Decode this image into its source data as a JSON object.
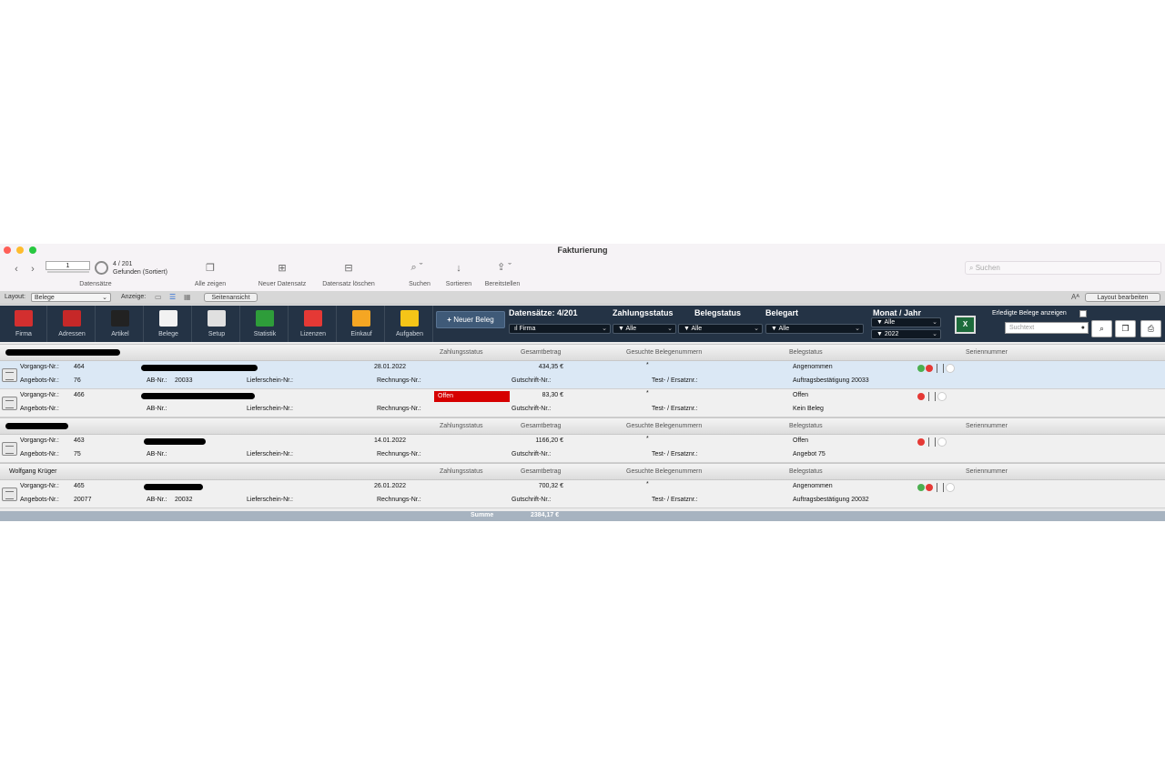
{
  "window": {
    "title": "Fakturierung"
  },
  "toolbar": {
    "record_input": "1",
    "record_count": "4 / 201",
    "record_found": "Gefunden (Sortiert)",
    "datensaetze_label": "Datensätze",
    "alle_zeigen": "Alle zeigen",
    "neuer_datensatz": "Neuer Datensatz",
    "datensatz_loeschen": "Datensatz löschen",
    "suchen": "Suchen",
    "sortieren": "Sortieren",
    "bereitstellen": "Bereitstellen",
    "search_placeholder": "Suchen"
  },
  "layoutbar": {
    "layout_label": "Layout:",
    "layout_value": "Belege",
    "anzeige_label": "Anzeige:",
    "seitenansicht": "Seitenansicht",
    "layout_bearbeiten": "Layout bearbeiten"
  },
  "nav": {
    "items": [
      {
        "label": "Firma",
        "icon": "home-icon",
        "color": "#d32f2f"
      },
      {
        "label": "Adressen",
        "icon": "contacts-icon",
        "color": "#c62828"
      },
      {
        "label": "Artikel",
        "icon": "shelves-icon",
        "color": "#222222"
      },
      {
        "label": "Belege",
        "icon": "document-icon",
        "color": "#f2f2f2"
      },
      {
        "label": "Setup",
        "icon": "tools-icon",
        "color": "#e0e0e0"
      },
      {
        "label": "Statistik",
        "icon": "chart-icon",
        "color": "#2e9d3a"
      },
      {
        "label": "Lizenzen",
        "icon": "license-icon",
        "color": "#e53935"
      },
      {
        "label": "Einkauf",
        "icon": "cart-icon",
        "color": "#f5a623"
      },
      {
        "label": "Aufgaben",
        "icon": "tasks-icon",
        "color": "#f5c518"
      }
    ],
    "new_beleg": "Neuer Beleg",
    "datensaetze_head": "Datensätze: 4/201",
    "firma_filter": "Firma",
    "zahlungsstatus_head": "Zahlungsstatus",
    "zahlungsstatus_filter": "Alle",
    "belegstatus_head": "Belegstatus",
    "belegstatus_filter": "Alle",
    "belegart_head": "Belegart",
    "belegart_filter": "Alle",
    "monat_jahr_head": "Monat / Jahr",
    "monat_filter": "Alle",
    "jahr_filter": "2022",
    "erledigte_label": "Erledigte Belege anzeigen",
    "suchtext_placeholder": "Suchtext"
  },
  "columns": {
    "zahlungsstatus": "Zahlungsstatus",
    "gesamtbetrag": "Gesamtbetrag",
    "gesuchte": "Gesuchte Belegenummern",
    "belegstatus": "Belegstatus",
    "seriennummer": "Seriennummer"
  },
  "labels": {
    "vorgangs": "Vorgangs-Nr.:",
    "angebots": "Angebots-Nr.:",
    "ab": "AB-Nr.:",
    "lieferschein": "Lieferschein-Nr.:",
    "rechnungs": "Rechnungs-Nr.:",
    "gutschrift": "Gutschrift-Nr.:",
    "test": "Test- / Ersatznr.:",
    "star": "*"
  },
  "groups": [
    {
      "name": "",
      "rows": [
        {
          "vorgang": "464",
          "angebot": "76",
          "ab": "20033",
          "date": "28.01.2022",
          "zahlung": "",
          "betrag": "434,35 €",
          "status": "Angenommen",
          "beleg": "Auftragsbestätigung 20033",
          "dots": [
            "#4caf50",
            "#e53935"
          ]
        },
        {
          "vorgang": "466",
          "angebot": "",
          "ab": "",
          "date": "",
          "zahlung": "Offen",
          "betrag": "83,30 €",
          "status": "Offen",
          "beleg": "Kein Beleg",
          "dots": [
            "#e53935"
          ]
        }
      ]
    },
    {
      "name": "",
      "rows": [
        {
          "vorgang": "463",
          "angebot": "75",
          "ab": "",
          "date": "14.01.2022",
          "zahlung": "",
          "betrag": "1166,20 €",
          "status": "Offen",
          "beleg": "Angebot 75",
          "dots": [
            "#e53935"
          ]
        }
      ]
    },
    {
      "name": "Wolfgang Krüger",
      "rows": [
        {
          "vorgang": "465",
          "angebot": "20077",
          "ab": "20032",
          "date": "26.01.2022",
          "zahlung": "",
          "betrag": "700,32 €",
          "status": "Angenommen",
          "beleg": "Auftragsbestätigung 20032",
          "dots": [
            "#4caf50",
            "#e53935"
          ]
        }
      ]
    }
  ],
  "summary": {
    "label": "Summe",
    "value": "2384,17 €"
  },
  "colors": {
    "navbar": "#243345",
    "selected_row": "#dbe8f5",
    "offen_red": "#d60000"
  }
}
